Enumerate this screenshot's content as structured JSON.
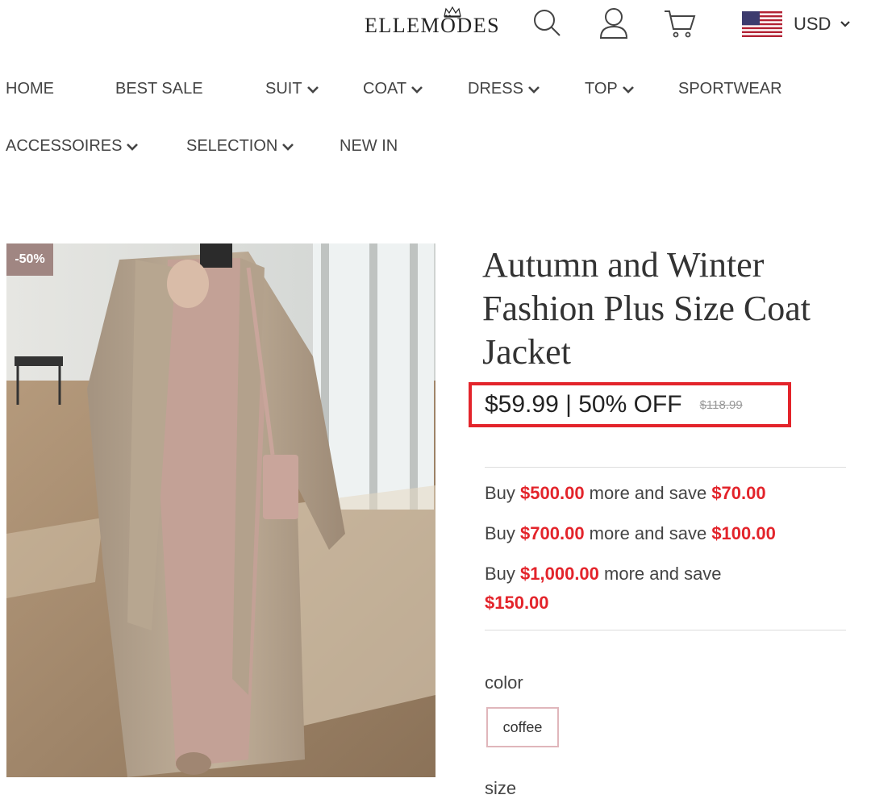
{
  "header": {
    "logo": "ELLEMÖDES",
    "icons": [
      "search-icon",
      "user-icon",
      "cart-icon"
    ],
    "currency": "USD"
  },
  "nav": {
    "items": [
      {
        "label": "HOME",
        "dropdown": false
      },
      {
        "label": "BEST SALE",
        "dropdown": false
      },
      {
        "label": "SUIT",
        "dropdown": true
      },
      {
        "label": "COAT",
        "dropdown": true
      },
      {
        "label": "DRESS",
        "dropdown": true
      },
      {
        "label": "TOP",
        "dropdown": true
      },
      {
        "label": "SPORTWEAR",
        "dropdown": false
      },
      {
        "label": "ACCESSOIRES",
        "dropdown": true
      },
      {
        "label": "SELECTION",
        "dropdown": true
      },
      {
        "label": "NEW IN",
        "dropdown": false
      }
    ]
  },
  "product": {
    "badge": "-50%",
    "title": "Autumn and Winter Fashion Plus Size Coat Jacket",
    "price": "$59.99 | 50% OFF",
    "old_price": "$118.99",
    "promos": [
      {
        "prefix": "Buy ",
        "amount": "$500.00",
        "middle": " more and save ",
        "save": "$70.00"
      },
      {
        "prefix": "Buy ",
        "amount": "$700.00",
        "middle": " more and save ",
        "save": "$100.00"
      },
      {
        "prefix": "Buy ",
        "amount": "$1,000.00",
        "middle": " more and save ",
        "save": "$150.00"
      }
    ],
    "color_label": "color",
    "color_option": "coffee",
    "size_label": "size"
  },
  "colors": {
    "accent_red": "#e3242b",
    "badge_bg": "#a08682",
    "swatch_border": "#e0b6bb"
  }
}
